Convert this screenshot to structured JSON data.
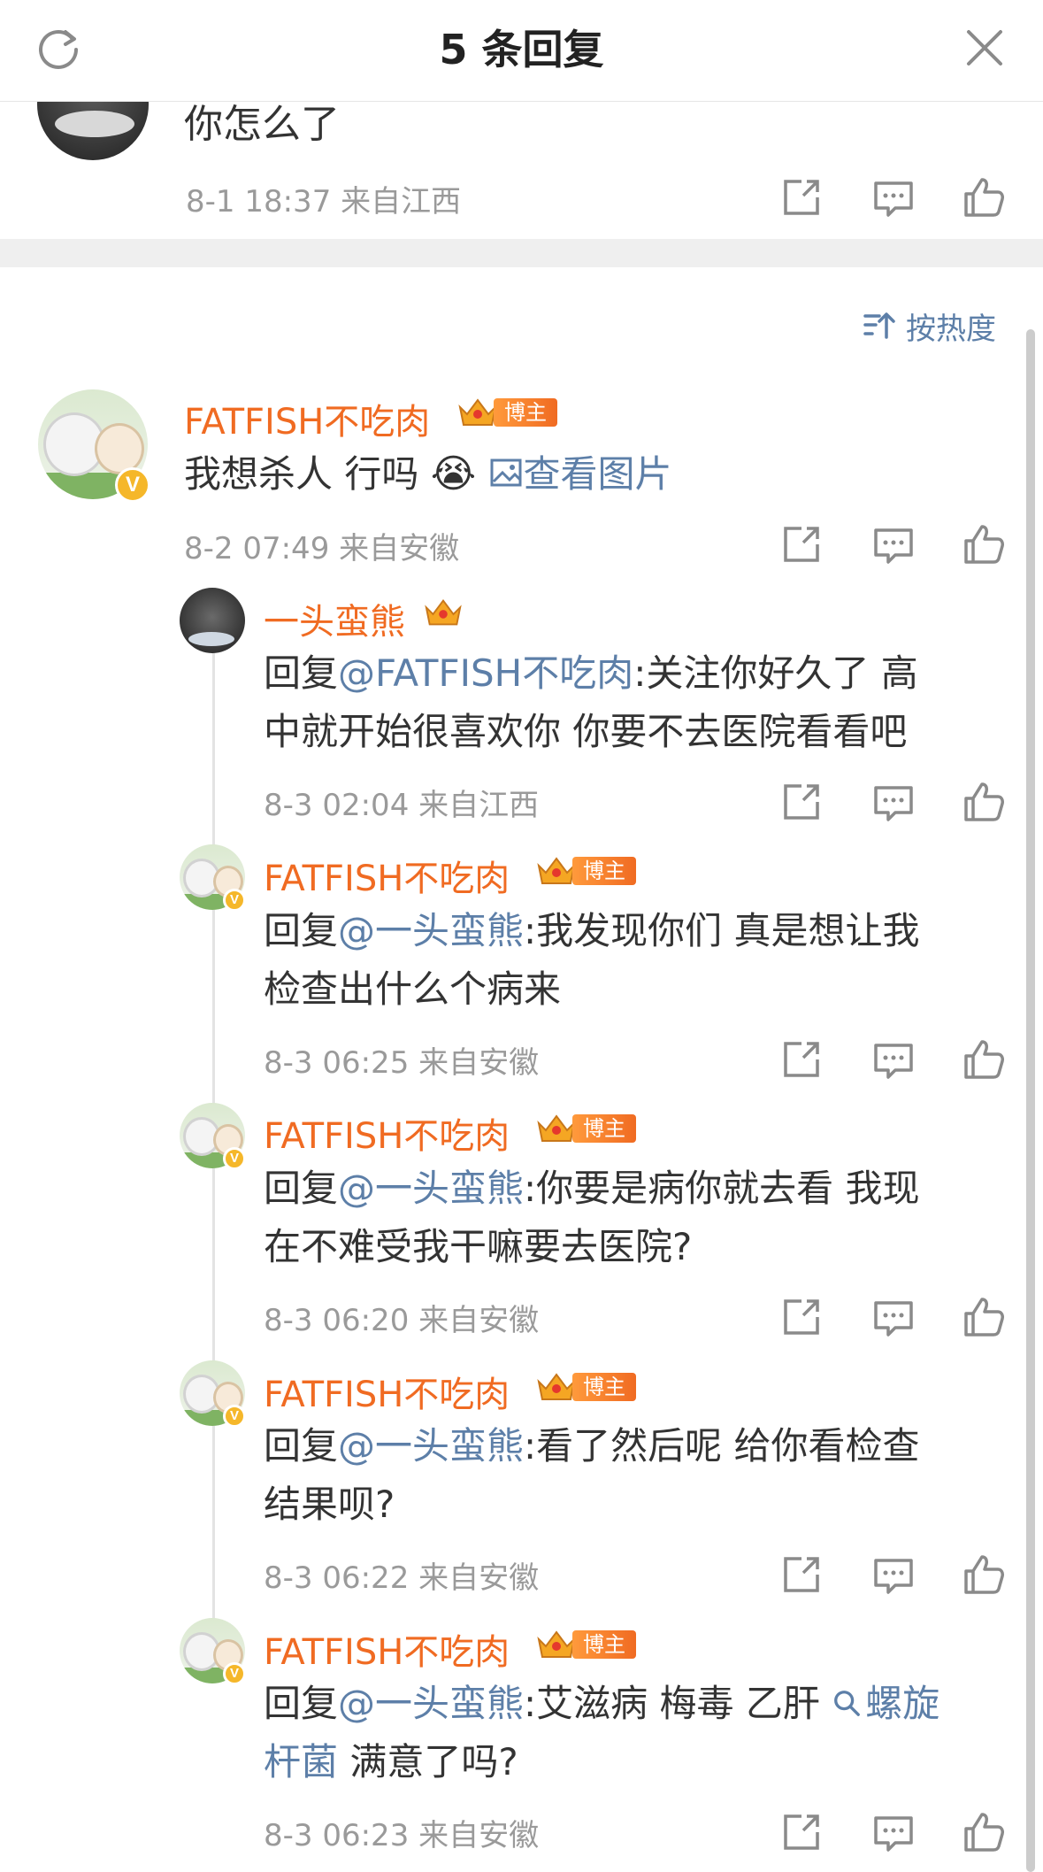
{
  "header": {
    "title": "5 条回复",
    "refresh_icon": "refresh-icon",
    "close_icon": "close-icon"
  },
  "top_comment": {
    "text": "你怎么了",
    "time": "8-1 18:37",
    "location": "来自江西"
  },
  "sort": {
    "icon": "sort-icon",
    "label": "按热度"
  },
  "main_comment": {
    "user": "FATFISH不吃肉",
    "badge": "博主",
    "text": "我想杀人 行吗",
    "emoji": "😭",
    "image_link": "查看图片",
    "time": "8-2 07:49",
    "location": "来自安徽"
  },
  "replies": [
    {
      "user": "一头蛮熊",
      "has_badge": false,
      "prefix": "回复",
      "mention": "@FATFISH不吃肉",
      "line1": ":关注你好久了 高",
      "line2": "中就开始很喜欢你 你要不去医院看看吧",
      "time": "8-3 02:04",
      "location": "来自江西"
    },
    {
      "user": "FATFISH不吃肉",
      "badge": "博主",
      "prefix": "回复",
      "mention": "@一头蛮熊",
      "line1": ":我发现你们 真是想让我",
      "line2": "检查出什么个病来",
      "time": "8-3 06:25",
      "location": "来自安徽"
    },
    {
      "user": "FATFISH不吃肉",
      "badge": "博主",
      "prefix": "回复",
      "mention": "@一头蛮熊",
      "line1": ":你要是病你就去看 我现",
      "line2": "在不难受我干嘛要去医院?",
      "time": "8-3 06:20",
      "location": "来自安徽"
    },
    {
      "user": "FATFISH不吃肉",
      "badge": "博主",
      "prefix": "回复",
      "mention": "@一头蛮熊",
      "line1": ":看了然后呢 给你看检查",
      "line2": "结果呗?",
      "time": "8-3 06:22",
      "location": "来自安徽"
    },
    {
      "user": "FATFISH不吃肉",
      "badge": "博主",
      "prefix": "回复",
      "mention": "@一头蛮熊",
      "line1": ":艾滋病 梅毒 乙肝 ",
      "search_link": "螺旋",
      "line2_link": "杆菌",
      "line2": " 满意了吗?",
      "time": "8-3 06:23",
      "location": "来自安徽"
    }
  ],
  "colors": {
    "username": "#f06b22",
    "link": "#5d7fa8",
    "meta": "#9a9a9a",
    "separator": "#efefef"
  }
}
